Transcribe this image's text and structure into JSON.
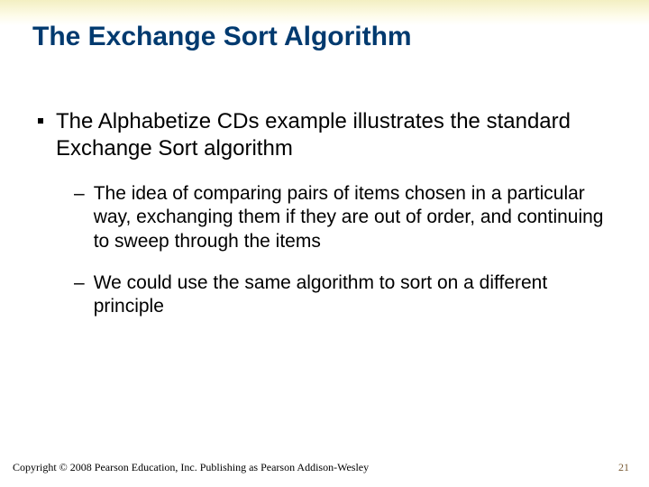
{
  "title": "The Exchange Sort Algorithm",
  "bullets": [
    {
      "text": "The Alphabetize CDs example illustrates the standard Exchange Sort algorithm",
      "sub": [
        "The idea of comparing pairs of items chosen in a particular way, exchanging them if they are out of order, and continuing to sweep through the items",
        "We could use the same algorithm to sort on a different principle"
      ]
    }
  ],
  "footer": "Copyright © 2008 Pearson Education, Inc. Publishing as Pearson Addison-Wesley",
  "page_number": "21"
}
